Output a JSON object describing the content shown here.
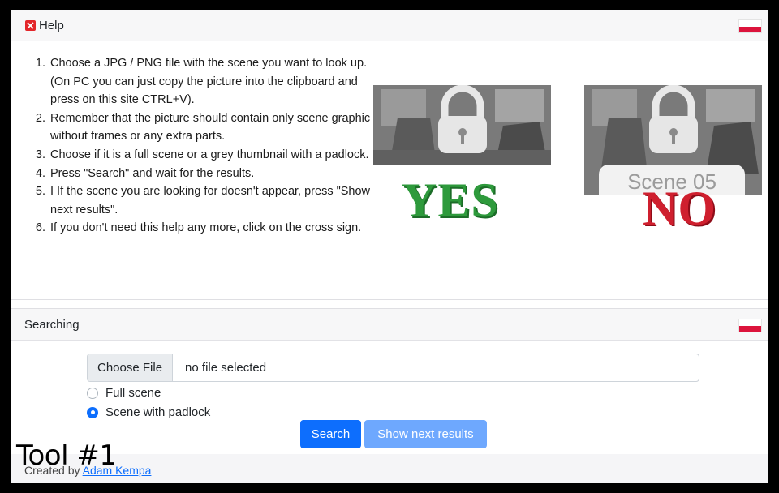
{
  "help": {
    "title": "Help",
    "steps": [
      "Choose a JPG / PNG file with the scene you want to look up. (On PC you can just copy the picture into the clipboard and press on this site CTRL+V).",
      "Remember that the picture should contain only scene graphic without frames or any extra parts.",
      "Choose if it is a full scene or a grey thumbnail with a padlock.",
      "Press \"Search\" and wait for the results.",
      "I If the scene you are looking for doesn't appear, press \"Show next results\".",
      "If you don't need this help any more, click on the cross sign."
    ],
    "example_yes": "YES",
    "example_no": "NO",
    "scene_label": "Scene 05"
  },
  "search": {
    "title": "Searching",
    "choose_file": "Choose File",
    "file_status": "no file selected",
    "options": [
      "Full scene",
      "Scene with padlock"
    ],
    "selected_option": "Scene with padlock",
    "search_button": "Search",
    "next_button": "Show next results"
  },
  "footer": {
    "created_by": "Created by",
    "author": "Adam Kempa"
  },
  "overlay_text": "Tool #1",
  "colors": {
    "close": "#e3262a",
    "flag_red": "#dc143c",
    "primary": "#0d6efd",
    "primary_disabled": "#6ea8fe",
    "yes": "#2e9a3c",
    "no": "#cf1f2e"
  }
}
